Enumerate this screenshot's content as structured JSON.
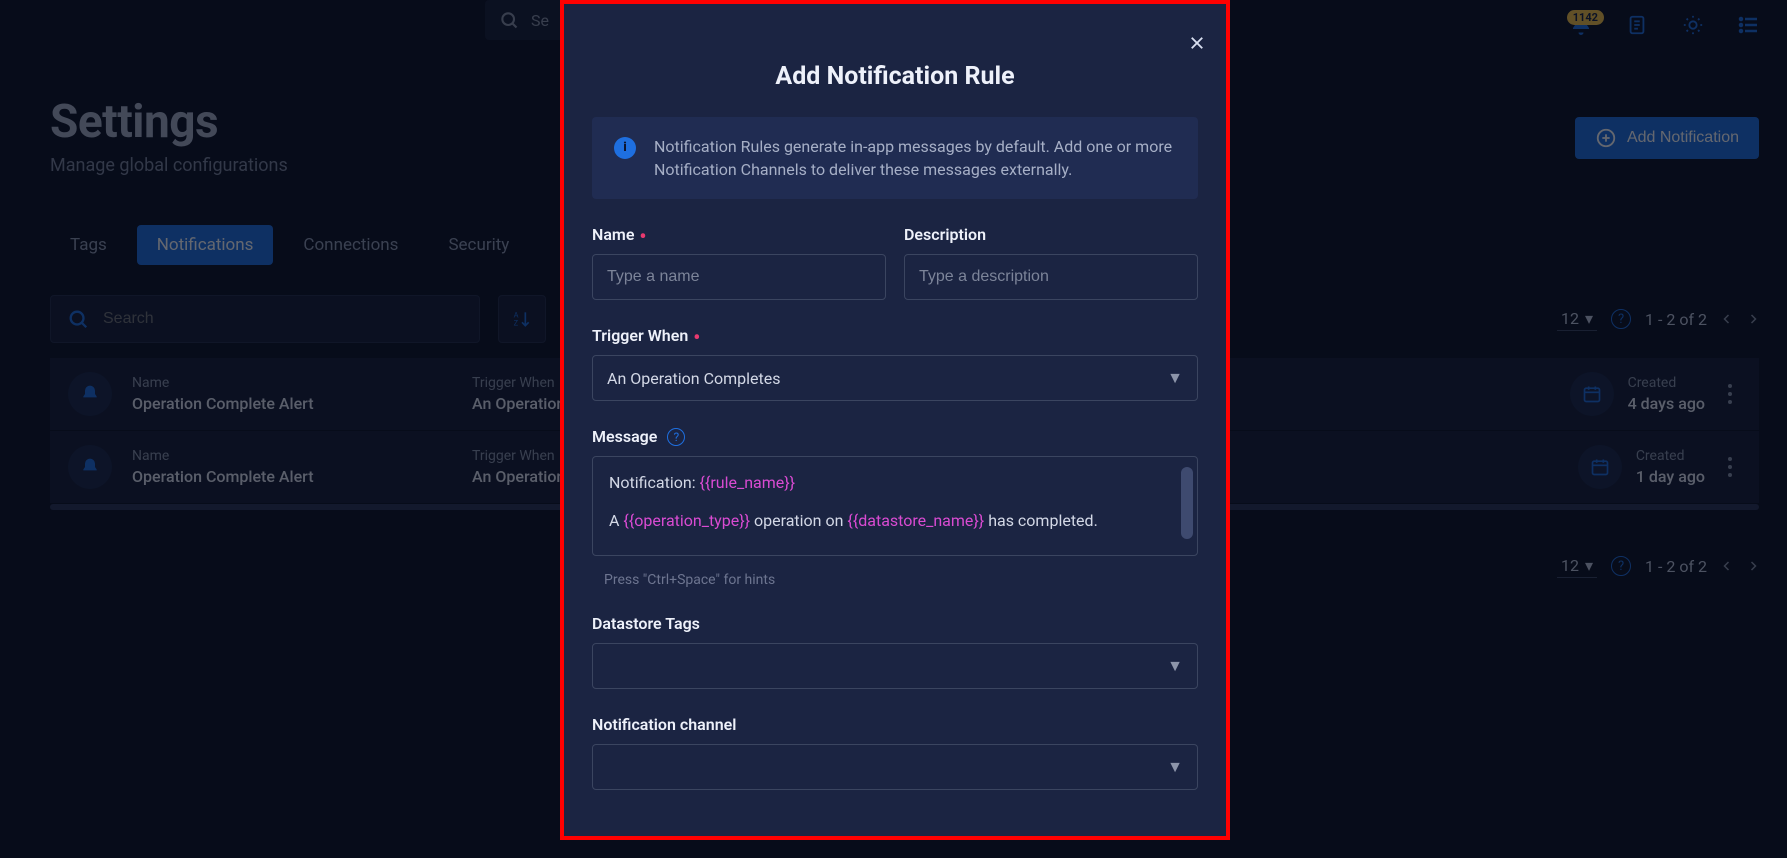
{
  "topbar": {
    "search_placeholder": "Se",
    "badge_count": "1142"
  },
  "header": {
    "title": "Settings",
    "subtitle": "Manage global configurations",
    "add_button": "Add Notification"
  },
  "tabs": [
    "Tags",
    "Notifications",
    "Connections",
    "Security"
  ],
  "active_tab_index": 1,
  "toolbar": {
    "search_placeholder": "Search",
    "per_page": "12",
    "range": "1 - 2 of 2"
  },
  "rows": [
    {
      "name_label": "Name",
      "name": "Operation Complete Alert",
      "trigger_label": "Trigger When",
      "trigger": "An Operation",
      "created_label": "Created",
      "created": "4 days ago"
    },
    {
      "name_label": "Name",
      "name": "Operation Complete Alert",
      "trigger_label": "Trigger When",
      "trigger": "An Operation",
      "created_label": "Created",
      "created": "1 day ago"
    }
  ],
  "paginator2": {
    "per_page": "12",
    "range": "1 - 2 of 2"
  },
  "modal": {
    "title": "Add Notification Rule",
    "info": "Notification Rules generate in-app messages by default. Add one or more Notification Channels to deliver these messages externally.",
    "name_label": "Name",
    "name_placeholder": "Type a name",
    "desc_label": "Description",
    "desc_placeholder": "Type a description",
    "trigger_label": "Trigger When",
    "trigger_value": "An Operation Completes",
    "message_label": "Message",
    "message_parts": {
      "p1a": "Notification: ",
      "t1": "{{rule_name}}",
      "p2a": "A ",
      "t2": "{{operation_type}}",
      "p2b": " operation on ",
      "t3": "{{datastore_name}}",
      "p2c": " has completed."
    },
    "message_hint": "Press \"Ctrl+Space\" for hints",
    "tags_label": "Datastore Tags",
    "channel_label": "Notification channel"
  }
}
